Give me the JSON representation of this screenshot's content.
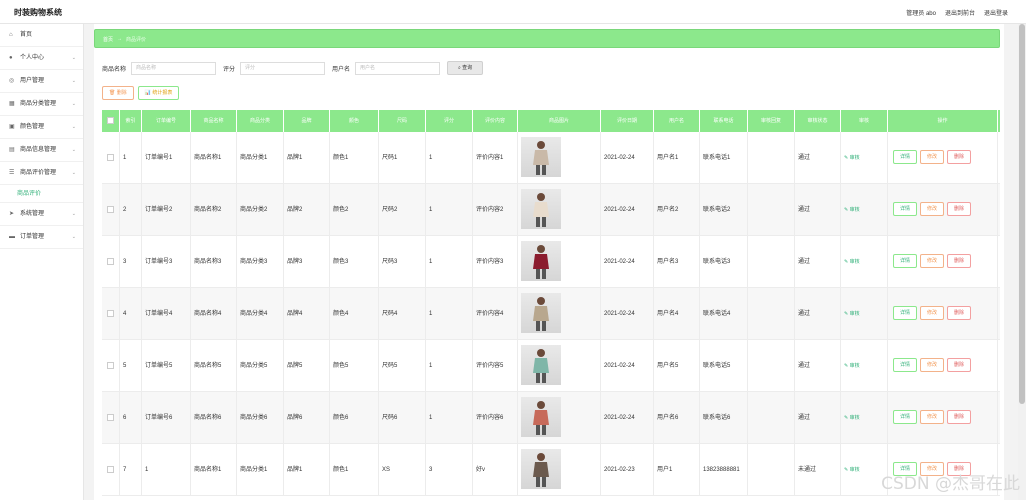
{
  "app": {
    "title": "时装购物系统"
  },
  "header": {
    "user": "管理员 abo",
    "to_front": "退出到前台",
    "logout": "退出登录"
  },
  "sidebar": {
    "items": [
      {
        "label": "首页",
        "icon": "home-icon",
        "glyph": "⌂",
        "chevron": false
      },
      {
        "label": "个人中心",
        "icon": "user-icon",
        "glyph": "●",
        "chevron": true
      },
      {
        "label": "用户管理",
        "icon": "users-icon",
        "glyph": "◎",
        "chevron": true
      },
      {
        "label": "商品分类管理",
        "icon": "grid-icon",
        "glyph": "▦",
        "chevron": true
      },
      {
        "label": "颜色管理",
        "icon": "palette-icon",
        "glyph": "▣",
        "chevron": true
      },
      {
        "label": "商品信息管理",
        "icon": "box-icon",
        "glyph": "▤",
        "chevron": true
      },
      {
        "label": "商品评价管理",
        "icon": "list-icon",
        "glyph": "☰",
        "chevron": true
      }
    ],
    "sub_item": "商品评价",
    "items_after": [
      {
        "label": "系统管理",
        "icon": "send-icon",
        "glyph": "➤",
        "chevron": true
      },
      {
        "label": "订单管理",
        "icon": "order-icon",
        "glyph": "▬",
        "chevron": true
      }
    ]
  },
  "breadcrumb": {
    "home": "首页",
    "arrow": "→",
    "current": "商品评价"
  },
  "search": {
    "name_label": "商品名称",
    "name_placeholder": "商品名称",
    "score_label": "评分",
    "score_placeholder": "评分",
    "user_label": "用户名",
    "user_placeholder": "用户名",
    "query_button": "⌕ 查询"
  },
  "actions": {
    "delete": "🗑 删除",
    "stats": "📊 统计报表"
  },
  "table": {
    "headers": [
      "",
      "索引",
      "订单编号",
      "商品名称",
      "商品分类",
      "品牌",
      "颜色",
      "尺码",
      "评分",
      "评价内容",
      "商品图片",
      "评价日期",
      "用户名",
      "联系电话",
      "审核回复",
      "审核状态",
      "审核",
      "操作"
    ],
    "rows": [
      [
        "1",
        "订单编号1",
        "商品名称1",
        "商品分类1",
        "品牌1",
        "颜色1",
        "尺码1",
        "1",
        "评价内容1",
        "2021-02-24",
        "用户名1",
        "联系电话1",
        "",
        "通过"
      ],
      [
        "2",
        "订单编号2",
        "商品名称2",
        "商品分类2",
        "品牌2",
        "颜色2",
        "尺码2",
        "1",
        "评价内容2",
        "2021-02-24",
        "用户名2",
        "联系电话2",
        "",
        "通过"
      ],
      [
        "3",
        "订单编号3",
        "商品名称3",
        "商品分类3",
        "品牌3",
        "颜色3",
        "尺码3",
        "1",
        "评价内容3",
        "2021-02-24",
        "用户名3",
        "联系电话3",
        "",
        "通过"
      ],
      [
        "4",
        "订单编号4",
        "商品名称4",
        "商品分类4",
        "品牌4",
        "颜色4",
        "尺码4",
        "1",
        "评价内容4",
        "2021-02-24",
        "用户名4",
        "联系电话4",
        "",
        "通过"
      ],
      [
        "5",
        "订单编号5",
        "商品名称5",
        "商品分类5",
        "品牌5",
        "颜色5",
        "尺码5",
        "1",
        "评价内容5",
        "2021-02-24",
        "用户名5",
        "联系电话5",
        "",
        "通过"
      ],
      [
        "6",
        "订单编号6",
        "商品名称6",
        "商品分类6",
        "品牌6",
        "颜色6",
        "尺码6",
        "1",
        "评价内容6",
        "2021-02-24",
        "用户名6",
        "联系电话6",
        "",
        "通过"
      ],
      [
        "7",
        "1",
        "商品名称1",
        "商品分类1",
        "品牌1",
        "颜色1",
        "XS",
        "3",
        "好v",
        "2021-02-23",
        "用户1",
        "13823888881",
        "",
        "未通过"
      ]
    ],
    "review_link": "✎ 审核",
    "op_detail": "详情",
    "op_edit": "修改",
    "op_delete": "删除",
    "product_colors": [
      "#c9b9a8",
      "#e8dccd",
      "#8b1c2e",
      "#b8a78e",
      "#7fb6a8",
      "#c76a5a",
      "#6b5a4e"
    ]
  },
  "watermark": "CSDN @杰哥在此"
}
